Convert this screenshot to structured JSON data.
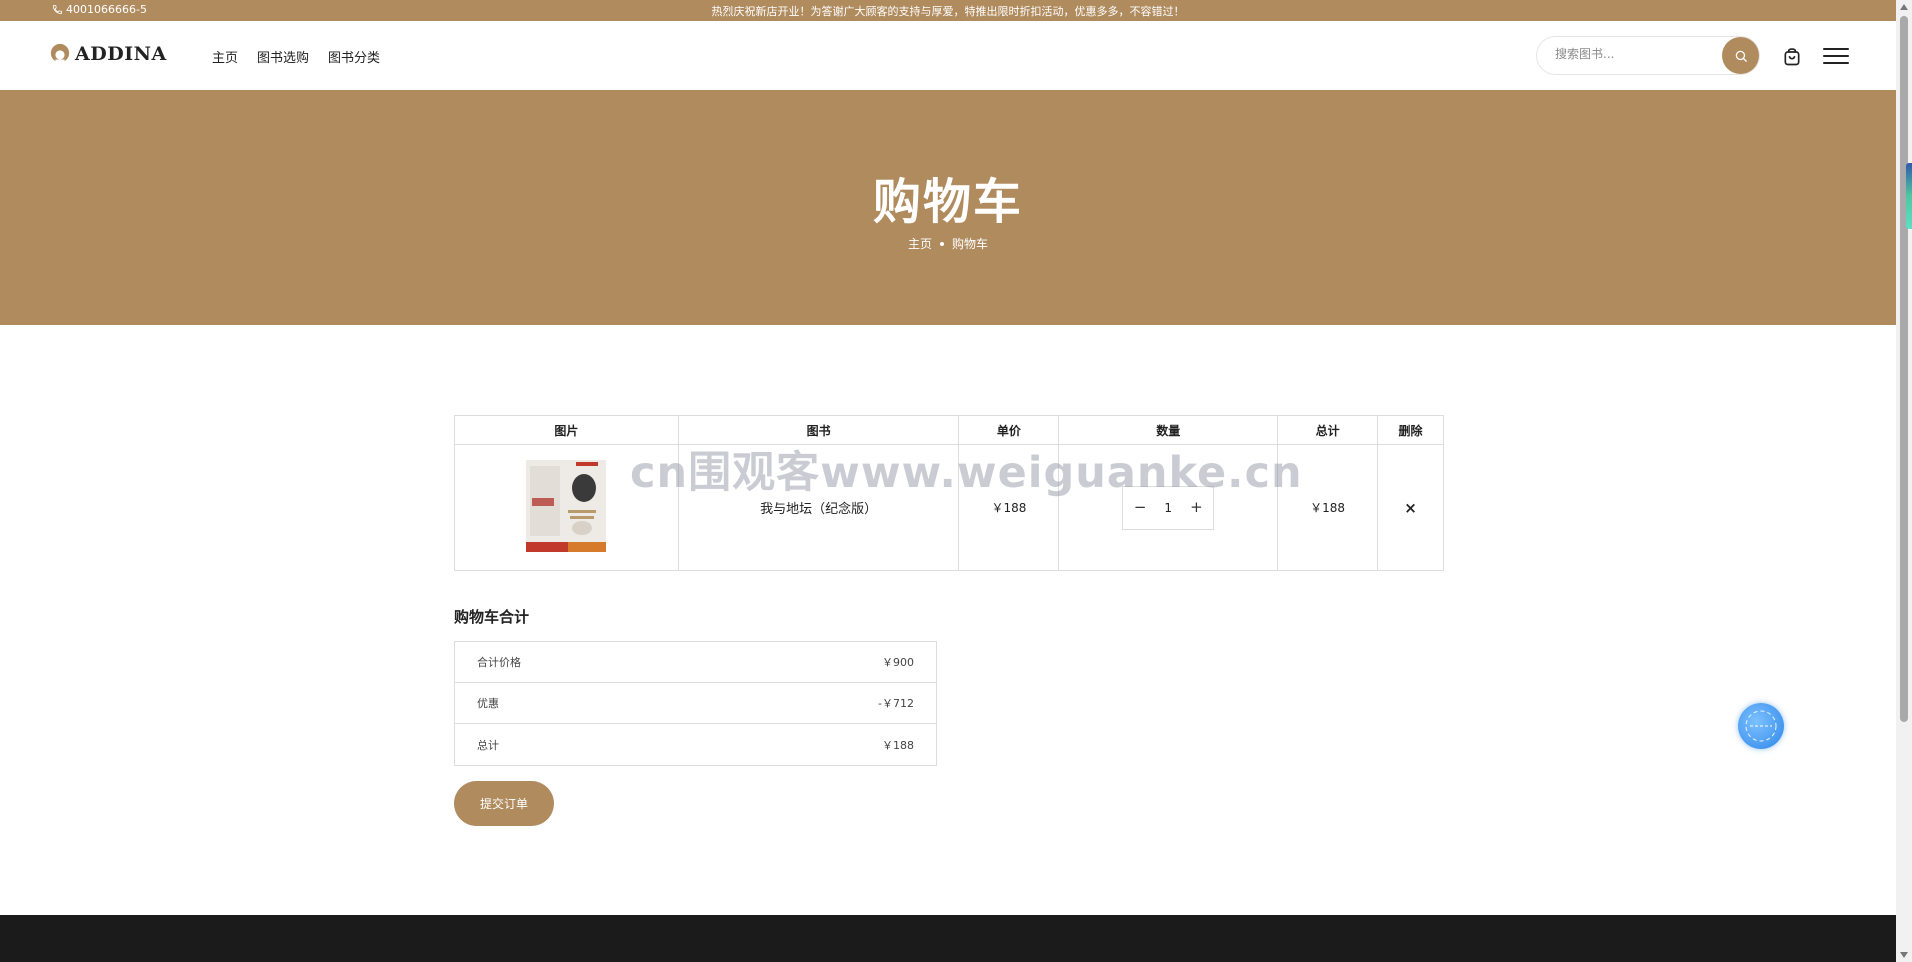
{
  "topbar": {
    "phone": "4001066666-5",
    "notice": "热烈庆祝新店开业！为答谢广大顾客的支持与厚爱，特推出限时折扣活动，优惠多多，不容错过！"
  },
  "header": {
    "logo_text": "ADDINA",
    "nav": [
      "主页",
      "图书选购",
      "图书分类"
    ],
    "search_placeholder": "搜索图书..."
  },
  "banner": {
    "title": "购物车",
    "breadcrumb": [
      "主页",
      "购物车"
    ]
  },
  "cart_table": {
    "headers": [
      "图片",
      "图书",
      "单价",
      "数量",
      "总计",
      "删除"
    ],
    "rows": [
      {
        "book": "我与地坛（纪念版）",
        "unit_price": "￥188",
        "quantity": "1",
        "total": "￥188",
        "remove": "×",
        "qty_minus": "−",
        "qty_plus": "+"
      }
    ]
  },
  "watermark": "cn围观客www.weiguanke.cn",
  "totals": {
    "title": "购物车合计",
    "rows": [
      {
        "label": "合计价格",
        "value": "￥900"
      },
      {
        "label": "优惠",
        "value": "-￥712"
      },
      {
        "label": "总计",
        "value": "￥188"
      }
    ],
    "submit_label": "提交订单"
  },
  "colors": {
    "accent": "#b08b5e",
    "footer": "#1b1b1b",
    "float_button": "#2e86e8"
  },
  "icons": {
    "phone": "phone-icon",
    "search": "search-icon",
    "cart": "shopping-bag-icon",
    "menu": "hamburger-menu-icon",
    "float": "assistant-icon"
  }
}
